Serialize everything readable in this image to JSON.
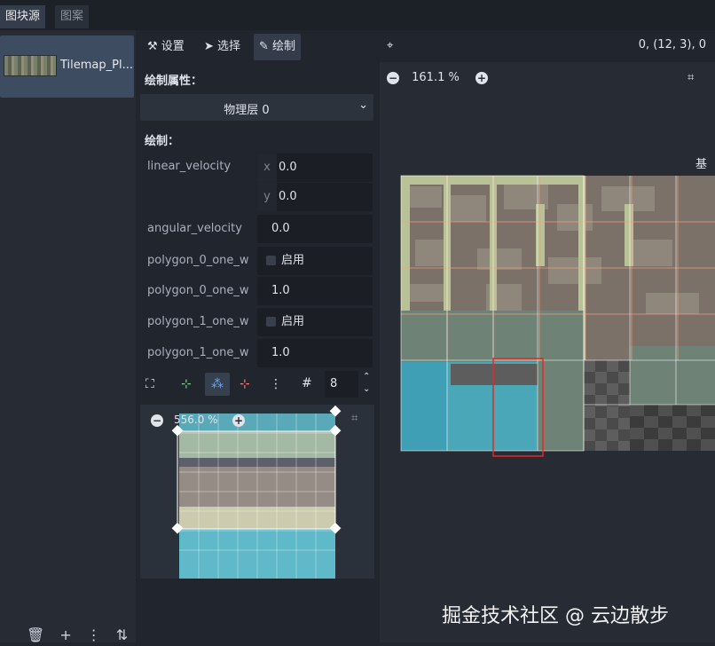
{
  "tabs": [
    {
      "label": "图块源",
      "active": true
    },
    {
      "label": "图案",
      "active": false
    }
  ],
  "source": {
    "label": "Tilemap_Pl..."
  },
  "toolbar": {
    "setup": "设置",
    "select": "选择",
    "paint": "绘制"
  },
  "coordinates": "0, (12, 3), 0",
  "paint_props": {
    "title": "绘制属性：",
    "dropdown_value": "物理层 0"
  },
  "paint_section": "绘制：",
  "props": {
    "linear_velocity": {
      "label": "linear_velocity",
      "x_axis": "x",
      "x": "0.0",
      "y_axis": "y",
      "y": "0.0"
    },
    "angular_velocity": {
      "label": "angular_velocity",
      "value": "0.0"
    },
    "polygon_0_one_w_a": {
      "label": "polygon_0_one_w",
      "value": "启用"
    },
    "polygon_0_one_w_b": {
      "label": "polygon_0_one_w",
      "value": "1.0"
    },
    "polygon_1_one_w_a": {
      "label": "polygon_1_one_w",
      "value": "启用"
    },
    "polygon_1_one_w_b": {
      "label": "polygon_1_one_w",
      "value": "1.0"
    }
  },
  "grid_snap": "8",
  "mini_zoom": "556.0 %",
  "main_zoom": "161.1 %",
  "side_label": "基",
  "watermark": "掘金技术社区 @ 云边散步",
  "colors": {
    "accent": "#4a8ef0",
    "selection": "#e02a2a",
    "panel": "#21262e"
  }
}
